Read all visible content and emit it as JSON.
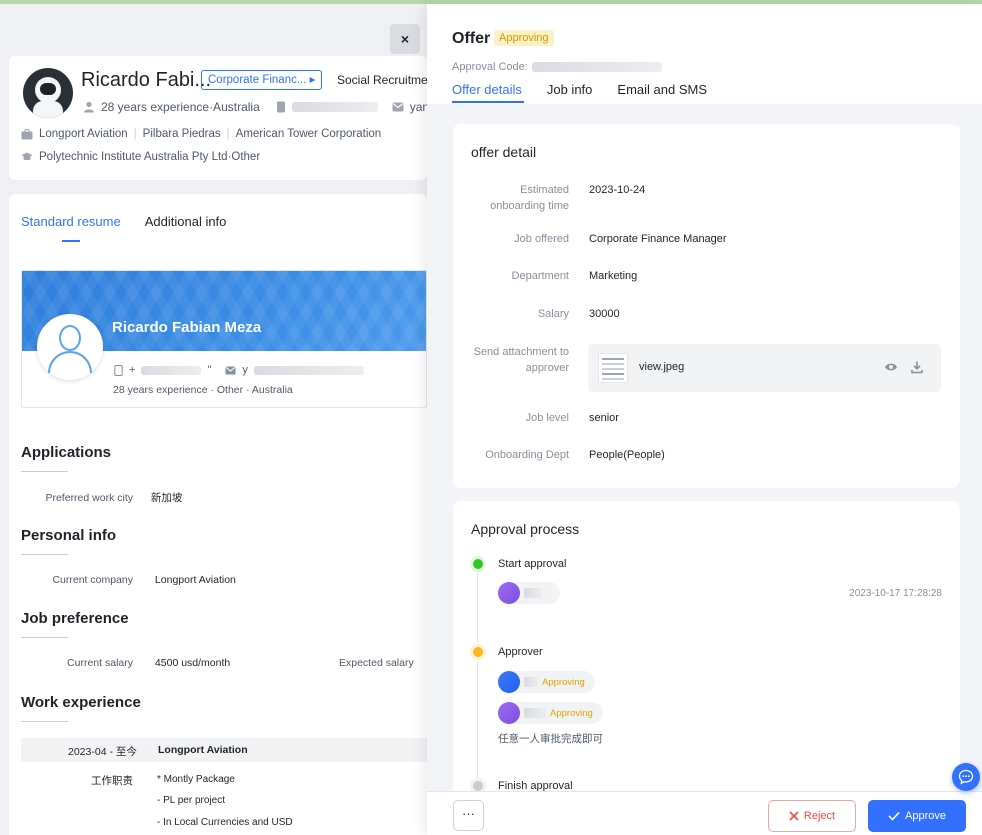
{
  "window": {
    "close_label": "×"
  },
  "candidate": {
    "name": "Ricardo Fabi...",
    "job_tag": "Corporate Financ...",
    "job_tag_arrow": "▸",
    "source": "Social Recruitmen",
    "experience_location": "28 years experience·Australia",
    "email_fragment": "yanl",
    "companies": [
      "Longport Aviation",
      "Pilbara Piedras",
      "American Tower Corporation"
    ],
    "education": "Polytechnic Institute Australia Pty Ltd·Other"
  },
  "left_tabs": [
    {
      "label": "Standard resume",
      "active": true
    },
    {
      "label": "Additional info",
      "active": false
    }
  ],
  "resume": {
    "name": "Ricardo Fabian Meza",
    "phone_fragment": "+",
    "phone_suffix": "\"",
    "email_fragment": "y",
    "subtitle": "28 years experience · Other · Australia"
  },
  "sections": {
    "applications": {
      "title": "Applications",
      "rows": [
        {
          "key": "Preferred work city",
          "value": "新加坡"
        }
      ]
    },
    "personal": {
      "title": "Personal info",
      "rows": [
        {
          "key": "Current company",
          "value": "Longport Aviation"
        }
      ]
    },
    "job_pref": {
      "title": "Job preference",
      "current_salary_key": "Current salary",
      "current_salary_value": "4500 usd/month",
      "expected_salary_key": "Expected salary"
    },
    "work": {
      "title": "Work experience",
      "period": "2023-04 - 至今",
      "company": "Longport Aviation",
      "duty_key": "工作职责",
      "bullets": [
        "* Montly Package",
        "- PL per project",
        "- In Local Currencies and USD"
      ]
    }
  },
  "drawer": {
    "title": "Offer",
    "status": "Approving",
    "approval_code_label": "Approval Code:",
    "tabs": [
      {
        "label": "Offer details",
        "active": true
      },
      {
        "label": "Job info",
        "active": false
      },
      {
        "label": "Email and SMS",
        "active": false
      }
    ]
  },
  "offer_detail": {
    "title": "offer detail",
    "fields": [
      {
        "label": "Estimated onboarding time",
        "value": "2023-10-24"
      },
      {
        "label": "Job offered",
        "value": "Corporate Finance Manager"
      },
      {
        "label": "Department",
        "value": "Marketing"
      },
      {
        "label": "Salary",
        "value": "30000"
      },
      {
        "label": "Send attachment to approver",
        "value": ""
      },
      {
        "label": "Job level",
        "value": "senior"
      },
      {
        "label": "Onboarding Dept",
        "value": "People(People)"
      }
    ],
    "attachment": {
      "file_name": "view.jpeg",
      "preview_icon": "eye-icon",
      "download_icon": "download-icon"
    }
  },
  "approval": {
    "title": "Approval process",
    "start_label": "Start approval",
    "start_time": "2023-10-17 17:28:28",
    "approver_label": "Approver",
    "approver_status": [
      "Approving",
      "Approving"
    ],
    "hint": "任意一人审批完成即可",
    "finish_label": "Finish approval"
  },
  "footer": {
    "more_label": "···",
    "reject_label": "Reject",
    "approve_label": "Approve"
  },
  "colors": {
    "accent": "#3370ff",
    "approving": "#e6a100",
    "reject": "#f54a45",
    "start_node": "#34c724",
    "approver_node": "#ffb41f"
  }
}
